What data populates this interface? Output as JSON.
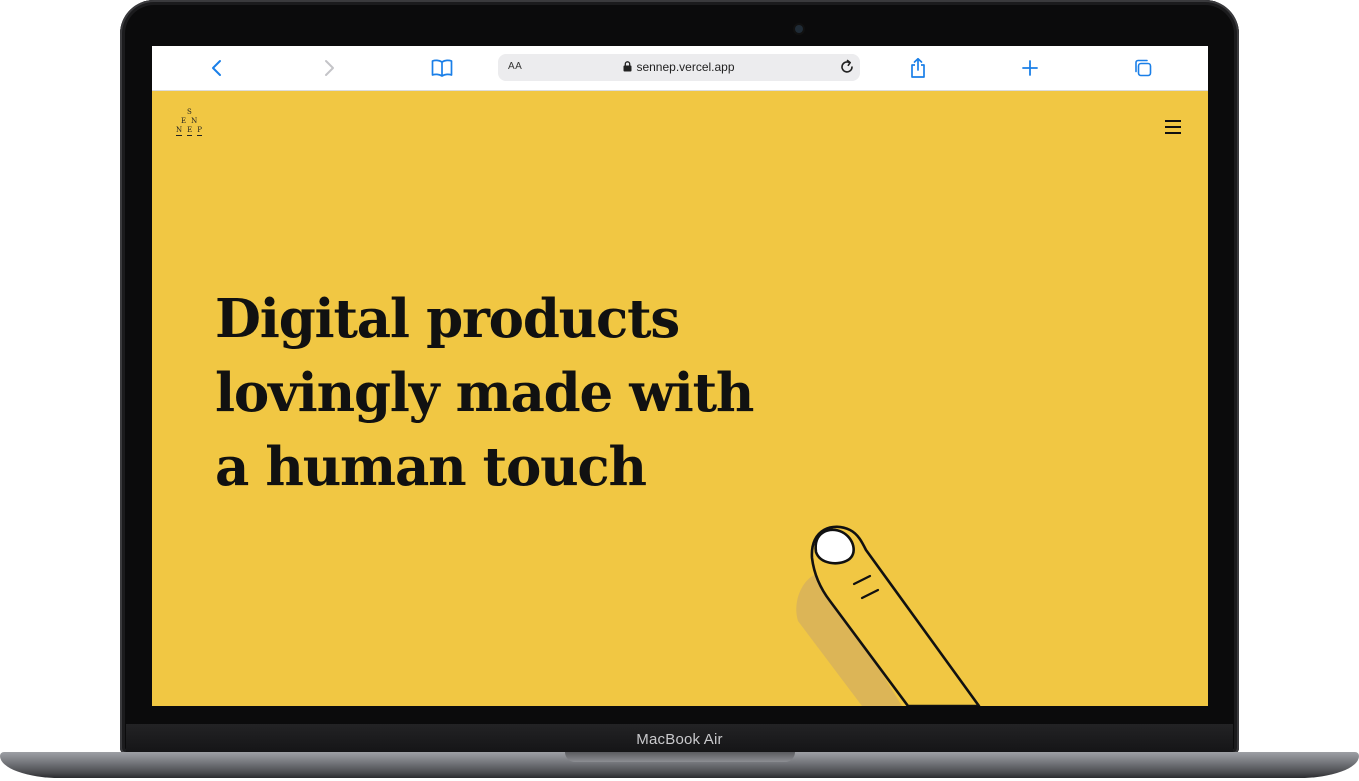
{
  "device": {
    "label": "MacBook Air"
  },
  "browser": {
    "text_size_label": "AA",
    "url": "sennep.vercel.app",
    "icons": [
      "back-icon",
      "forward-icon",
      "bookmarks-icon",
      "lock-icon",
      "reload-icon",
      "share-icon",
      "new-tab-icon",
      "tabs-icon"
    ]
  },
  "page": {
    "logo_rows": [
      [
        "S"
      ],
      [
        "E",
        "N"
      ],
      [
        "N",
        "E",
        "P"
      ]
    ],
    "headline": [
      "Digital products",
      "lovingly made with",
      "a human touch"
    ],
    "menu_icon": "hamburger-icon",
    "background_color": "#f1c743",
    "illustration": "finger-touch"
  }
}
